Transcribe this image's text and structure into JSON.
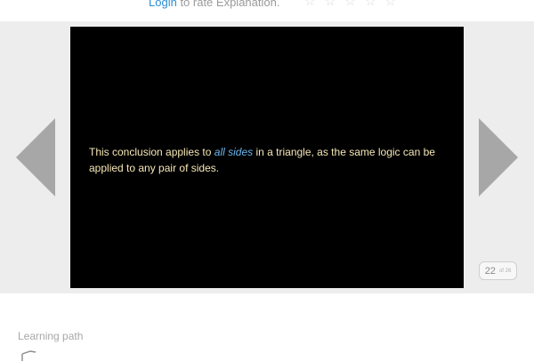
{
  "rating": {
    "login_label": "Login",
    "prompt_suffix": "to rate Explanation.",
    "stars": [
      "☆",
      "☆",
      "☆",
      "☆",
      "☆"
    ]
  },
  "slide": {
    "text_before": "This conclusion applies to",
    "text_emphasis": "all sides",
    "text_after": "in a triangle, as the same logic can be applied to any pair of sides."
  },
  "navigation": {
    "prev_icon": "triangle-left-icon",
    "next_icon": "triangle-right-icon"
  },
  "counter": {
    "current": "22",
    "total": "of 26"
  },
  "learning_path": {
    "label": "Learning path"
  },
  "colors": {
    "link": "#2a8fd6",
    "slide_background": "#000000",
    "slide_text": "#f6e7b5",
    "emphasis_text": "#6bb6ee",
    "arrow": "#a7a7a7"
  }
}
